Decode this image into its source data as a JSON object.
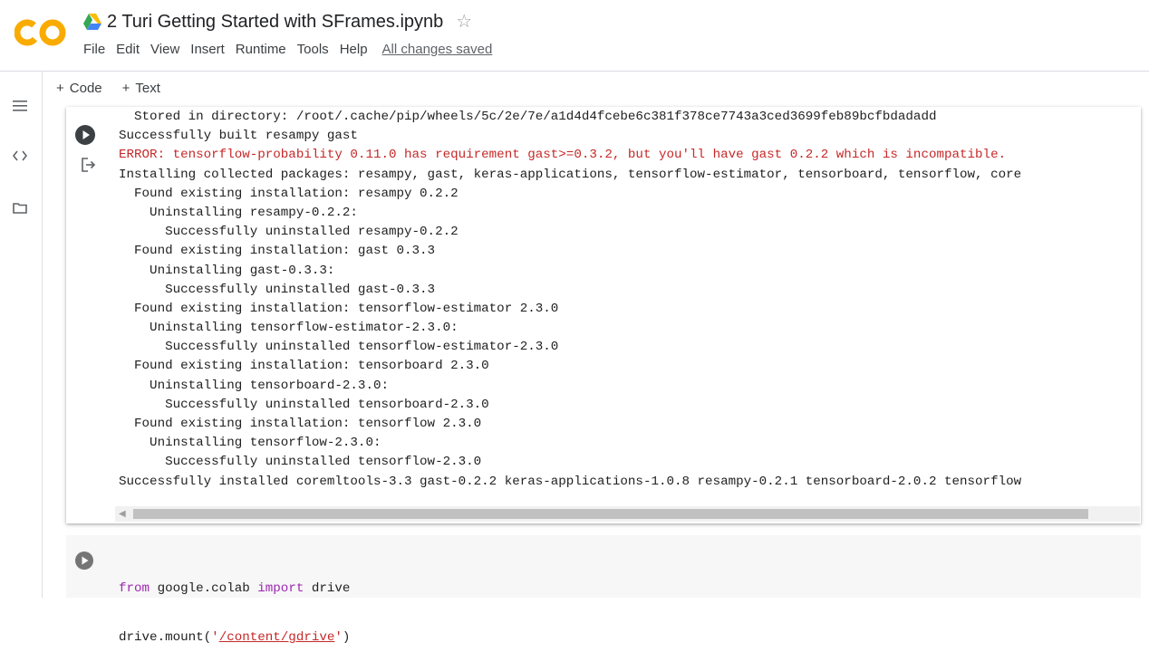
{
  "app": {
    "logo_text": "CO",
    "notebook_title": "2 Turi Getting Started with SFrames.ipynb",
    "save_status": "All changes saved"
  },
  "menu": [
    "File",
    "Edit",
    "View",
    "Insert",
    "Runtime",
    "Tools",
    "Help"
  ],
  "toolbar": {
    "add_code": "Code",
    "add_text": "Text",
    "plus": "+"
  },
  "sidebar": {
    "items": [
      {
        "icon": "toc-icon"
      },
      {
        "icon": "code-snippets-icon"
      },
      {
        "icon": "folder-icon"
      }
    ]
  },
  "output_lines": [
    {
      "text": "  Stored in directory: /root/.cache/pip/wheels/5c/2e/7e/a1d4d4fcebe6c381f378ce7743a3ced3699feb89bcfbdadadd",
      "error": false
    },
    {
      "text": "Successfully built resampy gast",
      "error": false
    },
    {
      "text": "ERROR: tensorflow-probability 0.11.0 has requirement gast>=0.3.2, but you'll have gast 0.2.2 which is incompatible.",
      "error": true
    },
    {
      "text": "Installing collected packages: resampy, gast, keras-applications, tensorflow-estimator, tensorboard, tensorflow, core",
      "error": false
    },
    {
      "text": "  Found existing installation: resampy 0.2.2",
      "error": false
    },
    {
      "text": "    Uninstalling resampy-0.2.2:",
      "error": false
    },
    {
      "text": "      Successfully uninstalled resampy-0.2.2",
      "error": false
    },
    {
      "text": "  Found existing installation: gast 0.3.3",
      "error": false
    },
    {
      "text": "    Uninstalling gast-0.3.3:",
      "error": false
    },
    {
      "text": "      Successfully uninstalled gast-0.3.3",
      "error": false
    },
    {
      "text": "  Found existing installation: tensorflow-estimator 2.3.0",
      "error": false
    },
    {
      "text": "    Uninstalling tensorflow-estimator-2.3.0:",
      "error": false
    },
    {
      "text": "      Successfully uninstalled tensorflow-estimator-2.3.0",
      "error": false
    },
    {
      "text": "  Found existing installation: tensorboard 2.3.0",
      "error": false
    },
    {
      "text": "    Uninstalling tensorboard-2.3.0:",
      "error": false
    },
    {
      "text": "      Successfully uninstalled tensorboard-2.3.0",
      "error": false
    },
    {
      "text": "  Found existing installation: tensorflow 2.3.0",
      "error": false
    },
    {
      "text": "    Uninstalling tensorflow-2.3.0:",
      "error": false
    },
    {
      "text": "      Successfully uninstalled tensorflow-2.3.0",
      "error": false
    },
    {
      "text": "Successfully installed coremltools-3.3 gast-0.2.2 keras-applications-1.0.8 resampy-0.2.1 tensorboard-2.0.2 tensorflow",
      "error": false
    }
  ],
  "code_cell": {
    "line1": {
      "kw1": "from",
      "mod": " google.colab ",
      "kw2": "import",
      "rest": " drive"
    },
    "line2": {
      "pre": "drive.mount(",
      "q1": "'",
      "path": "/content/gdrive",
      "q2": "'",
      "post": ")"
    }
  },
  "colors": {
    "logo_orange": "#F9AB00",
    "error_red": "#c62828",
    "keyword_purple": "#9c27b0"
  }
}
